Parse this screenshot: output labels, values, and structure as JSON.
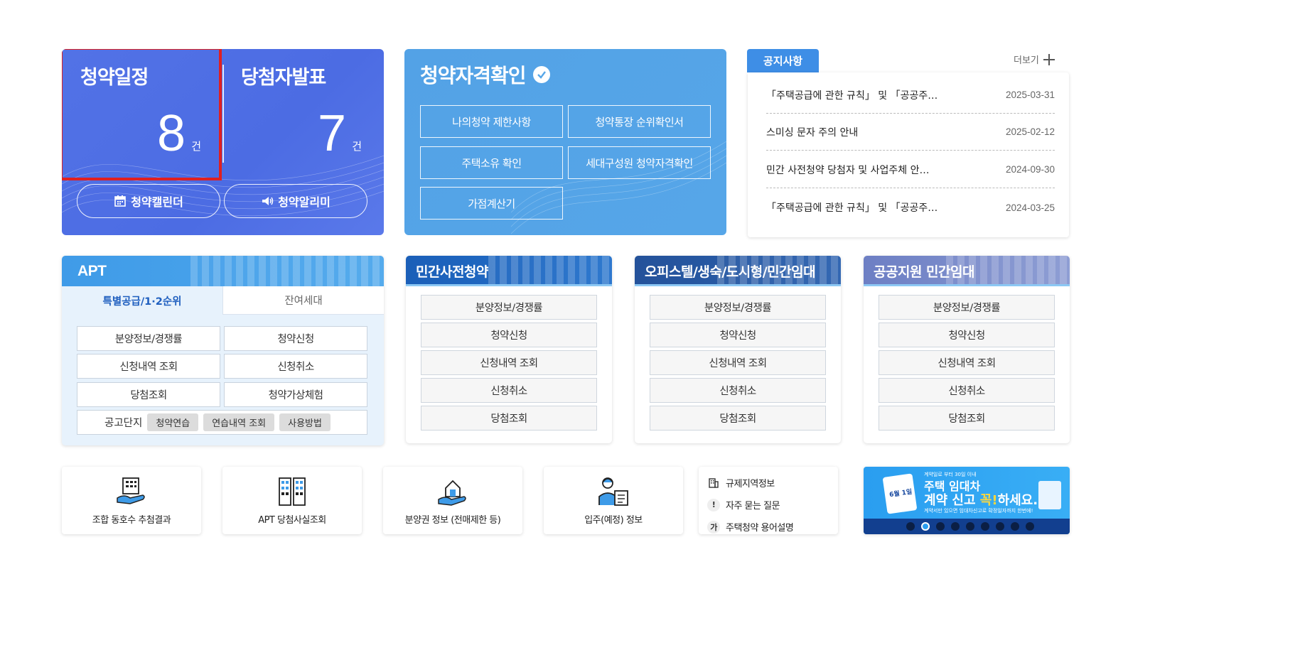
{
  "top_left": {
    "schedule_label": "청약일정",
    "schedule_count": "8",
    "winner_label": "당첨자발표",
    "winner_count": "7",
    "unit": "건",
    "calendar_button": "청약캘린더",
    "alarm_button": "청약알리미"
  },
  "qualification": {
    "title": "청약자격확인",
    "buttons": [
      "나의청약 제한사항",
      "청약통장 순위확인서",
      "주택소유 확인",
      "세대구성원 청약자격확인",
      "가점계산기"
    ]
  },
  "notice": {
    "tab": "공지사항",
    "more": "더보기",
    "items": [
      {
        "title": "「주택공급에 관한 규칙」 및 「공공주…",
        "date": "2025-03-31"
      },
      {
        "title": "스미싱 문자 주의 안내",
        "date": "2025-02-12"
      },
      {
        "title": "민간 사전청약 당첨자 및 사업주체 안…",
        "date": "2024-09-30"
      },
      {
        "title": "「주택공급에 관한 규칙」 및 「공공주…",
        "date": "2024-03-25"
      }
    ]
  },
  "apt": {
    "title": "APT",
    "tab_active": "특별공급/1·2순위",
    "tab_inactive": "잔여세대",
    "buttons": [
      "분양정보/경쟁률",
      "청약신청",
      "신청내역 조회",
      "신청취소",
      "당첨조회",
      "청약가상체험"
    ],
    "bar_label": "공고단지",
    "chips": [
      "청약연습",
      "연습내역 조회",
      "사용방법"
    ]
  },
  "pre_sale": {
    "title": "민간사전청약",
    "buttons": [
      "분양정보/경쟁률",
      "청약신청",
      "신청내역 조회",
      "신청취소",
      "당첨조회"
    ]
  },
  "officetel": {
    "title": "오피스텔/생숙/도시형/민간임대",
    "buttons": [
      "분양정보/경쟁률",
      "청약신청",
      "신청내역 조회",
      "신청취소",
      "당첨조회"
    ]
  },
  "public_rental": {
    "title": "공공지원 민간임대",
    "buttons": [
      "분양정보/경쟁률",
      "청약신청",
      "신청내역 조회",
      "신청취소",
      "당첨조회"
    ]
  },
  "bottom": {
    "cards": [
      "조합 동호수 추첨결과",
      "APT 당첨사실조회",
      "분양권 정보 (전매제한 등)",
      "입주(예정) 정보"
    ],
    "links": [
      {
        "icon": "building-small-icon",
        "label": "규제지역정보"
      },
      {
        "icon": "exclamation-icon",
        "label": "자주 묻는 질문",
        "glyph": "!"
      },
      {
        "icon": "ga-icon",
        "label": "주택청약 용어설명",
        "glyph": "가"
      }
    ]
  },
  "banner": {
    "top": "계약일로 부터 30일 이내",
    "line1": "주택 임대차",
    "line2_a": "계약 신고 ",
    "line2_b": "꼭!",
    "line2_c": "하세요.",
    "small": "계약서만 있으면 임대차신고로 확정일자까지 한번에!",
    "date": "6월 1일",
    "slides": 9,
    "active_slide": 2
  },
  "colors": {
    "primary_blue": "#4c6ce3",
    "sky_blue": "#56a6e8",
    "notice_blue": "#3e8ee6",
    "highlight_red": "#e02020"
  }
}
